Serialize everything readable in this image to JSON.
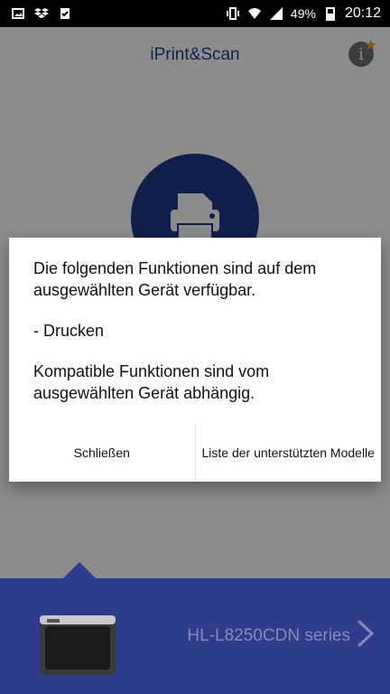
{
  "status_bar": {
    "battery": "49%",
    "time": "20:12"
  },
  "app": {
    "title": "iPrint&Scan"
  },
  "device": {
    "name": "HL-L8250CDN series"
  },
  "dialog": {
    "line1": "Die folgenden Funktionen sind auf dem ausgewählten Gerät verfügbar.",
    "line2": "- Drucken",
    "line3": "Kompatible Funktionen sind vom ausgewählten Gerät abhängig.",
    "close_label": "Schließen",
    "list_label": "Liste der unterstützten Modelle"
  },
  "icons": {
    "info": "info-icon",
    "star": "star-icon",
    "printer": "printer-icon",
    "chevron": "chevron-right-icon"
  }
}
